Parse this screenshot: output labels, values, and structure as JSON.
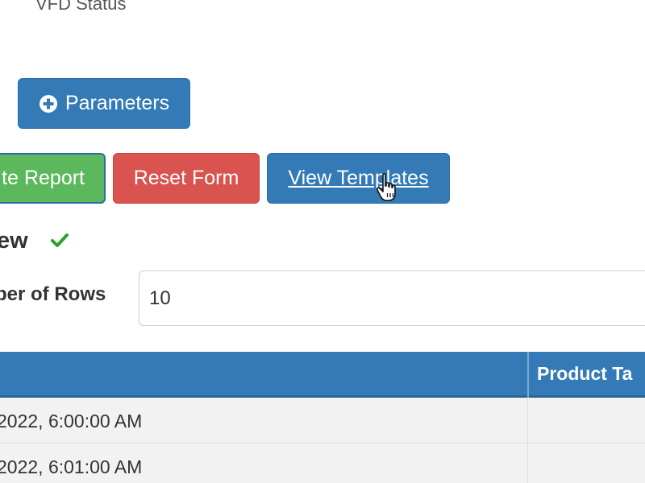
{
  "form": {
    "top_label": "VFD Status",
    "parameters_button": "Parameters",
    "parameters_icon": "plus-circle-icon",
    "generate_button": "te Report",
    "reset_button": "Reset Form",
    "templates_button": "View Templates"
  },
  "preview": {
    "heading": "ew",
    "status_icon": "check-icon",
    "rows_label": "ber of Rows",
    "rows_value": "10"
  },
  "table": {
    "headers": [
      "",
      "Product Ta"
    ],
    "rows": [
      {
        "time": "2022, 6:00:00 AM",
        "product": ""
      },
      {
        "time": "2022, 6:01:00 AM",
        "product": ""
      }
    ]
  },
  "colors": {
    "primary": "#337ab7",
    "success": "#5cb85c",
    "danger": "#d9534f",
    "check": "#2ea02e"
  }
}
